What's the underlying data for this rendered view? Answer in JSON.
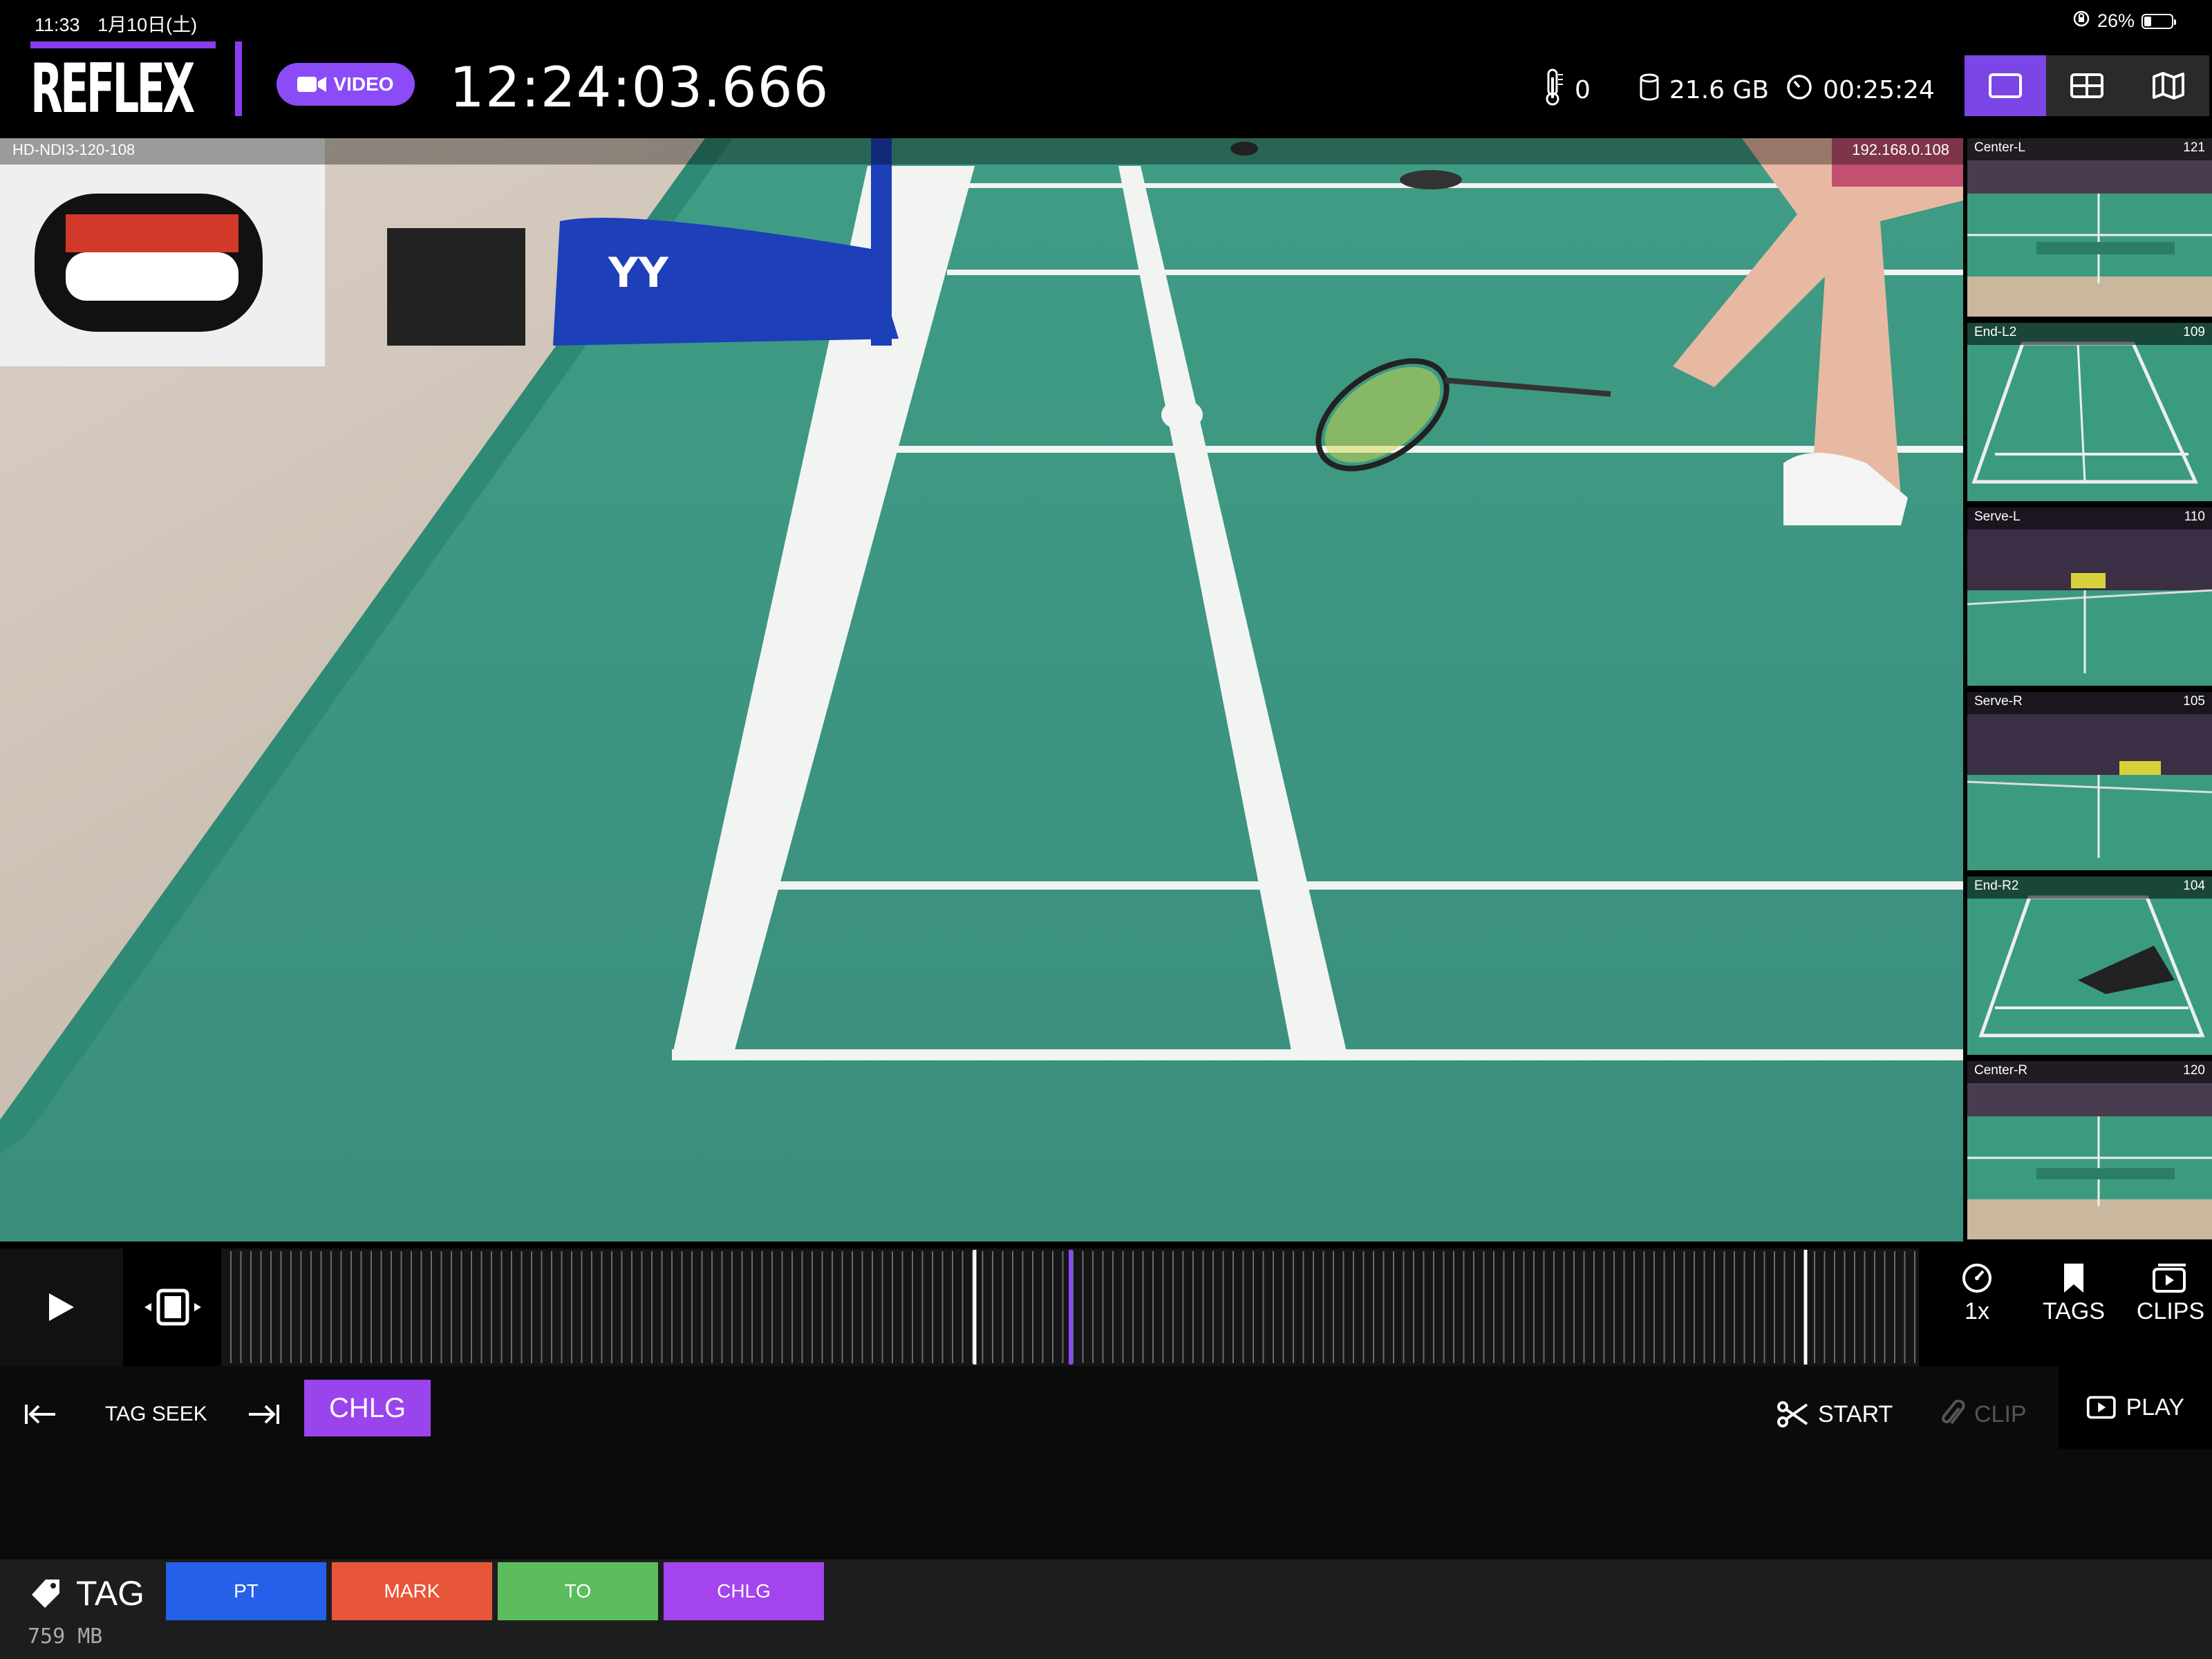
{
  "status": {
    "time": "11:33",
    "date": "1月10日(土)",
    "battery": "26%",
    "battery_level": 0.26
  },
  "app": {
    "logo": "REFLEX",
    "mode_label": "VIDEO",
    "timecode": "12:24:03.666",
    "temperature": "0",
    "storage": "21.6 GB",
    "elapsed": "00:25:24",
    "view_modes": [
      "single-view-icon",
      "grid-view-icon",
      "map-view-icon"
    ]
  },
  "main_camera": {
    "name": "HD-NDI3-120-108",
    "ip": "192.168.0.108"
  },
  "thumbnails": [
    {
      "name": "Center-L",
      "number": "121"
    },
    {
      "name": "End-L2",
      "number": "109"
    },
    {
      "name": "Serve-L",
      "number": "110"
    },
    {
      "name": "Serve-R",
      "number": "105"
    },
    {
      "name": "End-R2",
      "number": "104"
    },
    {
      "name": "Center-R",
      "number": "120"
    }
  ],
  "transport": {
    "speed": "1x",
    "tags": "TAGS",
    "clips": "CLIPS"
  },
  "controls": {
    "tag_seek": "TAG SEEK",
    "chlg": "CHLG",
    "start": "START",
    "clip": "CLIP",
    "play": "PLAY"
  },
  "tagbar": {
    "label": "TAG",
    "size": "759 MB",
    "buttons": [
      {
        "label": "PT",
        "color": "#2560e8"
      },
      {
        "label": "MARK",
        "color": "#e8563a"
      },
      {
        "label": "TO",
        "color": "#5bbd5e"
      },
      {
        "label": "CHLG",
        "color": "#a344ee"
      }
    ]
  },
  "colors": {
    "accent": "#8b4bf7",
    "court": "#3a9d86"
  }
}
